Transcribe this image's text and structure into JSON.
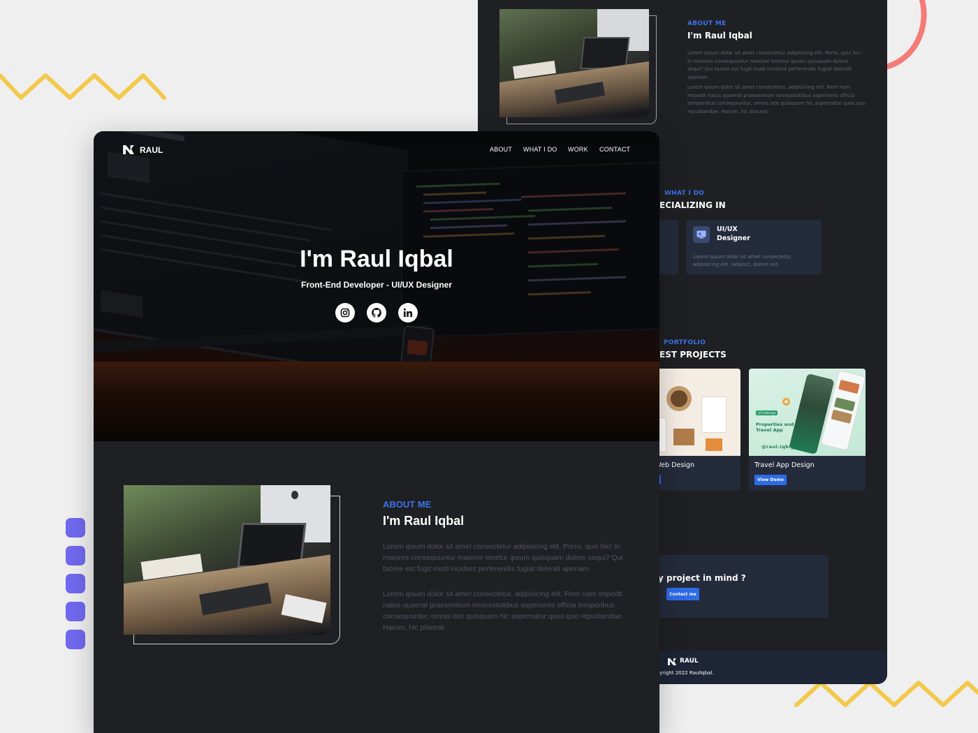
{
  "colors": {
    "accent": "#3d73e8",
    "bg_dark": "#1f2023",
    "card": "#242b3b",
    "zigzag": "#f2c94c",
    "dots": "#7069ee",
    "arc": "#f47b78"
  },
  "brand": {
    "logo_text": "RAUL"
  },
  "nav": {
    "items": [
      "ABOUT",
      "WHAT I DO",
      "WORK",
      "CONTACT"
    ]
  },
  "hero": {
    "title": "I'm Raul Iqbal",
    "subtitle": "Front-End Developer - UI/UX Designer",
    "social_icons": [
      "instagram-icon",
      "github-icon",
      "linkedin-icon"
    ]
  },
  "about": {
    "eyebrow": "ABOUT ME",
    "title": "I'm Raul Iqbal",
    "p1": "Lorem ipsum dolor sit amet consectetur adipisicing elit. Porro, quis hic! In maiores consequuntur maxime tenetur ipsum quisquam dolore sequi? Qui facere est fugit modi incidunt perferendis fugiat deleniti aperiam.",
    "p2": "Lorem ipsum dolor sit amet consectetur, adipisicing elit. Rem nam impedit natus quaerat praesentium necessitatibus asperiores officia temporibus consequuntur, omnis iste quisquam hic aspernatur quos quo repudiandae. Harum, hic placeat."
  },
  "whatido": {
    "eyebrow": "WHAT I DO",
    "title": "ECIALIZING IN",
    "card_title_1": "UI/UX",
    "card_title_2": "Designer",
    "card_text": "Lorem ipsum dolor sit amet consectetur, adipisicing elit. Adipisci, dolore est."
  },
  "portfolio": {
    "eyebrow": "PORTFOLIO",
    "title": "EST PROJECTS",
    "project1_title": "eet Web Design",
    "project2_title": "Travel App Design",
    "project2_button": "View Demo",
    "mock_tag": "UI Challenge",
    "mock_title_1": "Properties and",
    "mock_title_2": "Travel App",
    "mock_handle": "@raul.iqbl_"
  },
  "cta": {
    "text": "y project in mind ?",
    "button": "Contact me"
  },
  "footer": {
    "logo_text": "RAUL",
    "copyright": "yright 2022 RaulIqbal."
  }
}
